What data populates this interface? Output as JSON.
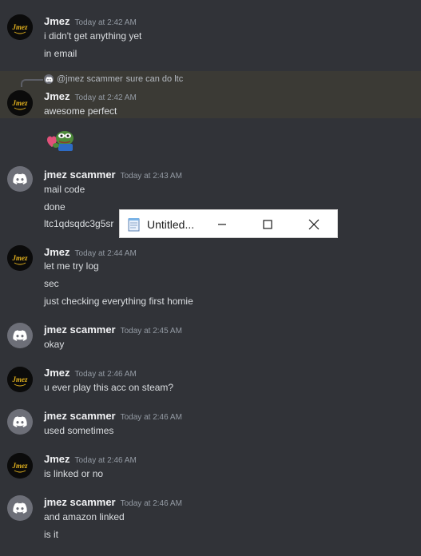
{
  "messages": [
    {
      "author": "Jmez",
      "timestamp": "Today at 2:42 AM",
      "lines": [
        "i didn't get anything yet",
        "in email"
      ]
    },
    {
      "author": "Jmez",
      "timestamp": "Today at 2:42 AM",
      "reply": {
        "mention": "@jmez scammer",
        "text": "sure can do ltc"
      },
      "lines": [
        "awesome perfect"
      ],
      "emoji": "pepe-hug-emoji"
    },
    {
      "author": "jmez scammer",
      "timestamp": "Today at 2:43 AM",
      "lines": [
        "mail code",
        "done",
        "ltc1qdsqdc3g5sr"
      ]
    },
    {
      "author": "Jmez",
      "timestamp": "Today at 2:44 AM",
      "lines": [
        "let me try log",
        "sec",
        "just checking everything first homie"
      ]
    },
    {
      "author": "jmez scammer",
      "timestamp": "Today at 2:45 AM",
      "lines": [
        "okay"
      ]
    },
    {
      "author": "Jmez",
      "timestamp": "Today at 2:46 AM",
      "lines": [
        "u ever play this acc on steam?"
      ]
    },
    {
      "author": "jmez scammer",
      "timestamp": "Today at 2:46 AM",
      "lines": [
        "used sometimes"
      ]
    },
    {
      "author": "Jmez",
      "timestamp": "Today at 2:46 AM",
      "lines": [
        "is linked or no"
      ]
    },
    {
      "author": "jmez scammer",
      "timestamp": "Today at 2:46 AM",
      "lines": [
        "and amazon linked",
        "is it"
      ]
    }
  ],
  "notepad": {
    "title": "Untitled...",
    "icon": "notepad-icon",
    "buttons": [
      "minimize-icon",
      "maximize-icon",
      "close-icon"
    ]
  },
  "colors": {
    "background": "#313338",
    "highlight": "#3b3a35",
    "author": "#f2f3f5",
    "timestamp": "#949ba4",
    "text": "#dbdee1",
    "discord_avatar": "#6d6f78"
  }
}
